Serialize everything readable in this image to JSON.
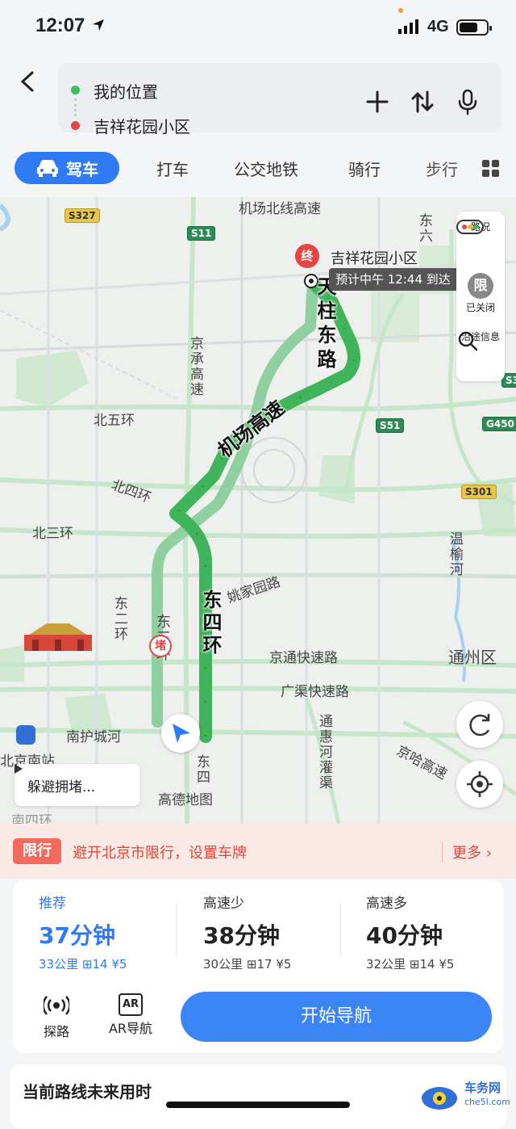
{
  "status_bar": {
    "time": "12:07",
    "network": "4G"
  },
  "route_input": {
    "origin": "我的位置",
    "destination": "吉祥花园小区"
  },
  "mode_tabs": [
    "驾车",
    "打车",
    "公交地铁",
    "骑行",
    "步行"
  ],
  "map": {
    "destination_pin": "终",
    "destination_label": "吉祥花园小区",
    "eta_label": "预计中午 12:44 到达",
    "jam_marker": "堵",
    "side_panel": {
      "traffic": "路况",
      "restriction": "已关闭",
      "restriction_icon": "限",
      "along_route": "沿途信息"
    },
    "avoid_button": "躲避拥堵...",
    "road_labels": {
      "tianzhu": "天柱东路",
      "airport_expressway": "机场高速",
      "east_4th_ring": "东四环",
      "east_4th_ring_small": "东四",
      "east_3rd_ring": "东三环",
      "east_2nd_ring": "东二环",
      "north_5th": "北五环",
      "north_4th": "北四环",
      "north_3rd": "北三环",
      "airport_north": "机场北线高速",
      "jingcheng": "京承高速",
      "yaojiayuan": "姚家园路",
      "jingtong": "京通快速路",
      "guangqu": "广渠快速路",
      "tonghui": "通惠河灌渠",
      "jingha": "京哈高速",
      "wenyu": "温榆河",
      "tongzhou": "通州区",
      "nanhucheng": "南护城河",
      "beijing_south": "北京南站",
      "east_6th": "东六",
      "south_4th": "南四环",
      "amap": "高德地图"
    },
    "shields": [
      "S327",
      "S11",
      "S51",
      "G450",
      "S301",
      "S3"
    ]
  },
  "restriction_bar": {
    "tag": "限行",
    "text": "避开北京市限行，设置车牌",
    "more": "更多"
  },
  "route_options": [
    {
      "name": "推荐",
      "duration": "37分钟",
      "distance": "33公里",
      "lights": "14",
      "cost": "¥5"
    },
    {
      "name": "高速少",
      "duration": "38分钟",
      "distance": "30公里",
      "lights": "17",
      "cost": "¥5"
    },
    {
      "name": "高速多",
      "duration": "40分钟",
      "distance": "32公里",
      "lights": "14",
      "cost": "¥5"
    }
  ],
  "tools": {
    "explore": "探路",
    "ar": "AR导航",
    "ar_icon": "AR"
  },
  "start_button": "开始导航",
  "bottom_card": {
    "title": "当前路线未来用时"
  },
  "watermark": {
    "name": "车务网",
    "url": "che5l.com"
  },
  "colors": {
    "accent": "#2f7af5",
    "route": "#3fb45a",
    "route_alt": "#8fcfa0",
    "restrict": "#e0463a"
  }
}
